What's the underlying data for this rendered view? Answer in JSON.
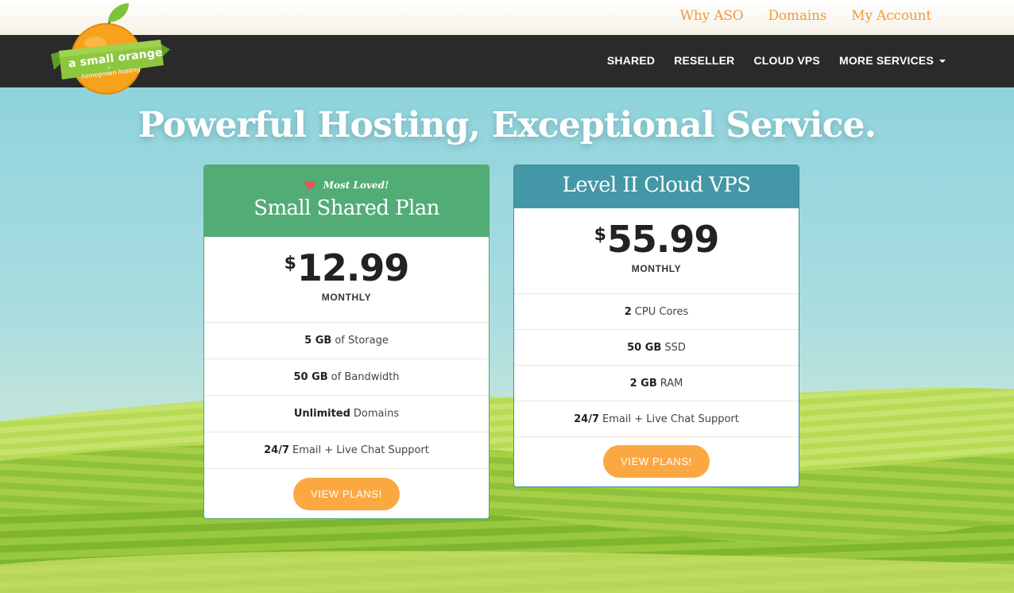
{
  "top_links": [
    "Why ASO",
    "Domains",
    "My Account"
  ],
  "logo": {
    "name": "a small orange",
    "tagline": "homegrown hosting",
    "small": "a"
  },
  "nav": {
    "items": [
      "SHARED",
      "RESELLER",
      "CLOUD VPS",
      "MORE SERVICES"
    ]
  },
  "hero": {
    "headline": "Powerful Hosting, Exceptional Service."
  },
  "plans": {
    "shared": {
      "badge": "Most Loved!",
      "title": "Small Shared Plan",
      "currency": "$",
      "price": "12.99",
      "period": "MONTHLY",
      "features": [
        {
          "bold": "5 GB",
          "text": "of Storage"
        },
        {
          "bold": "50 GB",
          "text": "of Bandwidth"
        },
        {
          "bold": "Unlimited",
          "text": "Domains"
        },
        {
          "bold": "24/7",
          "text": "Email + Live Chat Support"
        }
      ],
      "button": "VIEW PLANS!"
    },
    "vps": {
      "title": "Level II Cloud VPS",
      "currency": "$",
      "price": "55.99",
      "period": "MONTHLY",
      "features": [
        {
          "bold": "2",
          "text": "CPU Cores"
        },
        {
          "bold": "50 GB",
          "text": "SSD"
        },
        {
          "bold": "2 GB",
          "text": "RAM"
        },
        {
          "bold": "24/7",
          "text": "Email + Live Chat Support"
        }
      ],
      "button": "VIEW PLANS!"
    }
  },
  "colors": {
    "accent_orange": "#fba843",
    "link_orange": "#f29a3a",
    "shared_green": "#52ac76",
    "vps_teal": "#4397a6",
    "nav_dark": "#2a2a2a",
    "heart_red": "#e2555c"
  },
  "icons": {
    "badge_icon": "heart-icon",
    "dropdown_icon": "caret-down-icon",
    "logo_leaf": "leaf-icon"
  }
}
